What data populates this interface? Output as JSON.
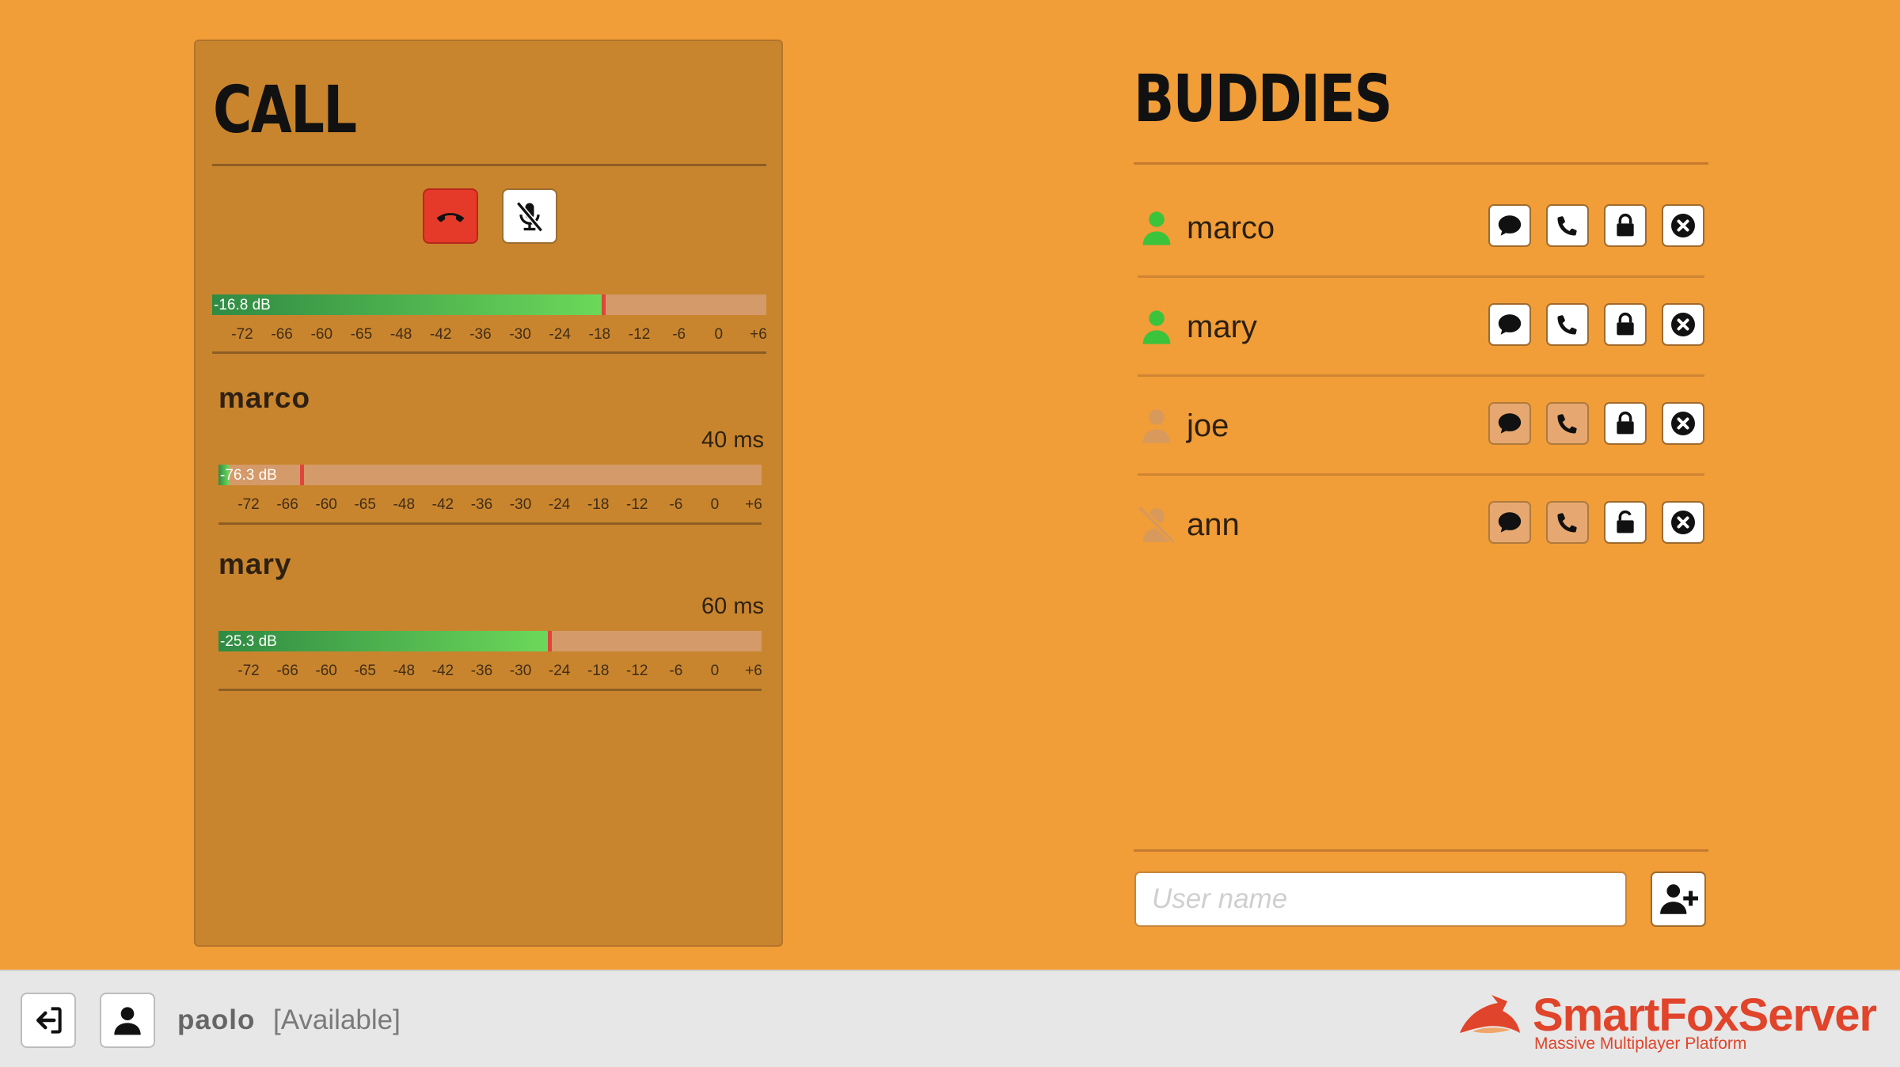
{
  "call": {
    "title": "CALL",
    "hangup_icon": "hangup-icon",
    "mute_icon": "microphone-muted-icon",
    "own_meter": {
      "label": "-16.8 dB",
      "level_db": -16.8
    },
    "scale": [
      "-72",
      "-66",
      "-60",
      "-65",
      "-48",
      "-42",
      "-36",
      "-30",
      "-24",
      "-18",
      "-12",
      "-6",
      "0",
      "+6"
    ],
    "participants": [
      {
        "name": "marco",
        "latency": "40 ms",
        "meter_label": "-76.3 dB",
        "level_db": -76.3,
        "peak_db": -65
      },
      {
        "name": "mary",
        "latency": "60 ms",
        "meter_label": "-25.3 dB",
        "level_db": -25.3,
        "peak_db": -25.3
      }
    ]
  },
  "buddies": {
    "title": "BUDDIES",
    "list": [
      {
        "name": "marco",
        "status": "online",
        "chat_enabled": true,
        "call_enabled": true,
        "blocked": true
      },
      {
        "name": "mary",
        "status": "online",
        "chat_enabled": true,
        "call_enabled": true,
        "blocked": true
      },
      {
        "name": "joe",
        "status": "offline",
        "chat_enabled": false,
        "call_enabled": false,
        "blocked": true
      },
      {
        "name": "ann",
        "status": "blocked",
        "chat_enabled": false,
        "call_enabled": false,
        "blocked": false
      }
    ],
    "add_placeholder": "User name"
  },
  "footer": {
    "username": "paolo",
    "presence": "[Available]",
    "logo_text": "SmartFoxServer",
    "logo_tagline": "Massive Multiplayer Platform"
  },
  "colors": {
    "background": "#f19d38",
    "panel": "#c9852e",
    "online": "#3cc33c",
    "hangup": "#e53a2a",
    "brand": "#e0442a"
  }
}
